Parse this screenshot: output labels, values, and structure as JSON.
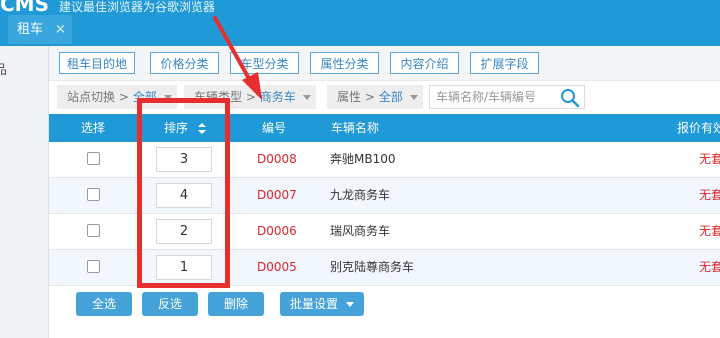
{
  "header": {
    "logo": "CMS",
    "title": "建议最佳浏览器为谷歌浏览器"
  },
  "tab": {
    "label": "租车",
    "close": "×"
  },
  "sidebar": {
    "label": "品"
  },
  "toolbar": [
    "租车目的地",
    "价格分类",
    "车型分类",
    "属性分类",
    "内容介绍",
    "扩展字段"
  ],
  "filters": {
    "site": {
      "label": "站点切换 > ",
      "value": "全部"
    },
    "type": {
      "label": "车辆类型 > ",
      "value": "商务车"
    },
    "attr": {
      "label": "属性 > ",
      "value": "全部"
    },
    "search_placeholder": "车辆名称/车辆编号"
  },
  "table": {
    "headers": {
      "select": "选择",
      "sort": "排序",
      "code": "编号",
      "name": "车辆名称",
      "price": "报价有效"
    },
    "rows": [
      {
        "sort": "3",
        "code": "D0008",
        "name": "奔驰MB100",
        "price": "无套餐"
      },
      {
        "sort": "4",
        "code": "D0007",
        "name": "九龙商务车",
        "price": "无套餐"
      },
      {
        "sort": "2",
        "code": "D0006",
        "name": "瑞风商务车",
        "price": "无套餐"
      },
      {
        "sort": "1",
        "code": "D0005",
        "name": "别克陆尊商务车",
        "price": "无套餐"
      }
    ]
  },
  "actions": {
    "select_all": "全选",
    "invert": "反选",
    "delete": "删除",
    "batch": "批量设置"
  },
  "colors": {
    "primary": "#1f9ad6",
    "highlight": "#e62e2e",
    "code_text": "#d9272b"
  }
}
